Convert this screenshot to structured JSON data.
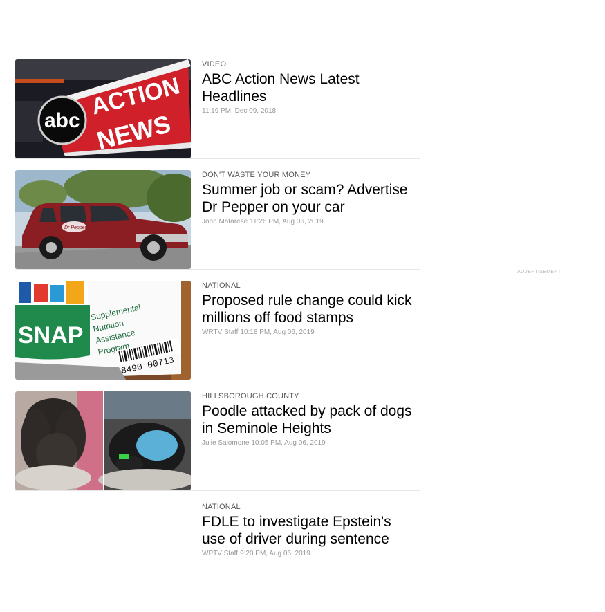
{
  "advertisement": {
    "label": "ADVERTISEMENT"
  },
  "articles": [
    {
      "category": "VIDEO",
      "headline": "ABC Action News Latest Headlines",
      "author": "",
      "timestamp": "11:19 PM, Dec 09, 2018",
      "image": "abc-action-news-logo"
    },
    {
      "category": "DON'T WASTE YOUR MONEY",
      "headline": "Summer job or scam? Advertise Dr Pepper on your car",
      "author": "John Matarese",
      "timestamp": "11:26 PM, Aug 06, 2019",
      "image": "red-suv-dr-pepper"
    },
    {
      "category": "NATIONAL",
      "headline": "Proposed rule change could kick millions off food stamps",
      "author": "WRTV Staff",
      "timestamp": "10:18 PM, Aug 06, 2019",
      "image": "snap-card"
    },
    {
      "category": "HILLSBOROUGH COUNTY",
      "headline": "Poodle attacked by pack of dogs in Seminole Heights",
      "author": "Julie Salomone",
      "timestamp": "10:05 PM, Aug 06, 2019",
      "image": "poodle-photos"
    },
    {
      "category": "NATIONAL",
      "headline": "FDLE to investigate Epstein's use of driver during sentence",
      "author": "WPTV Staff",
      "timestamp": "9:20 PM, Aug 06, 2019",
      "image": ""
    }
  ],
  "thumbnail_text": {
    "abc": "abc",
    "action": "ACTION",
    "news": "NEWS",
    "snap": "SNAP",
    "snap_line1": "Supplemental",
    "snap_line2": "Nutrition",
    "snap_line3": "Assistance",
    "snap_line4": "Program",
    "barcode_number": "8490 00713",
    "car_decal": "Dr Pepper"
  }
}
